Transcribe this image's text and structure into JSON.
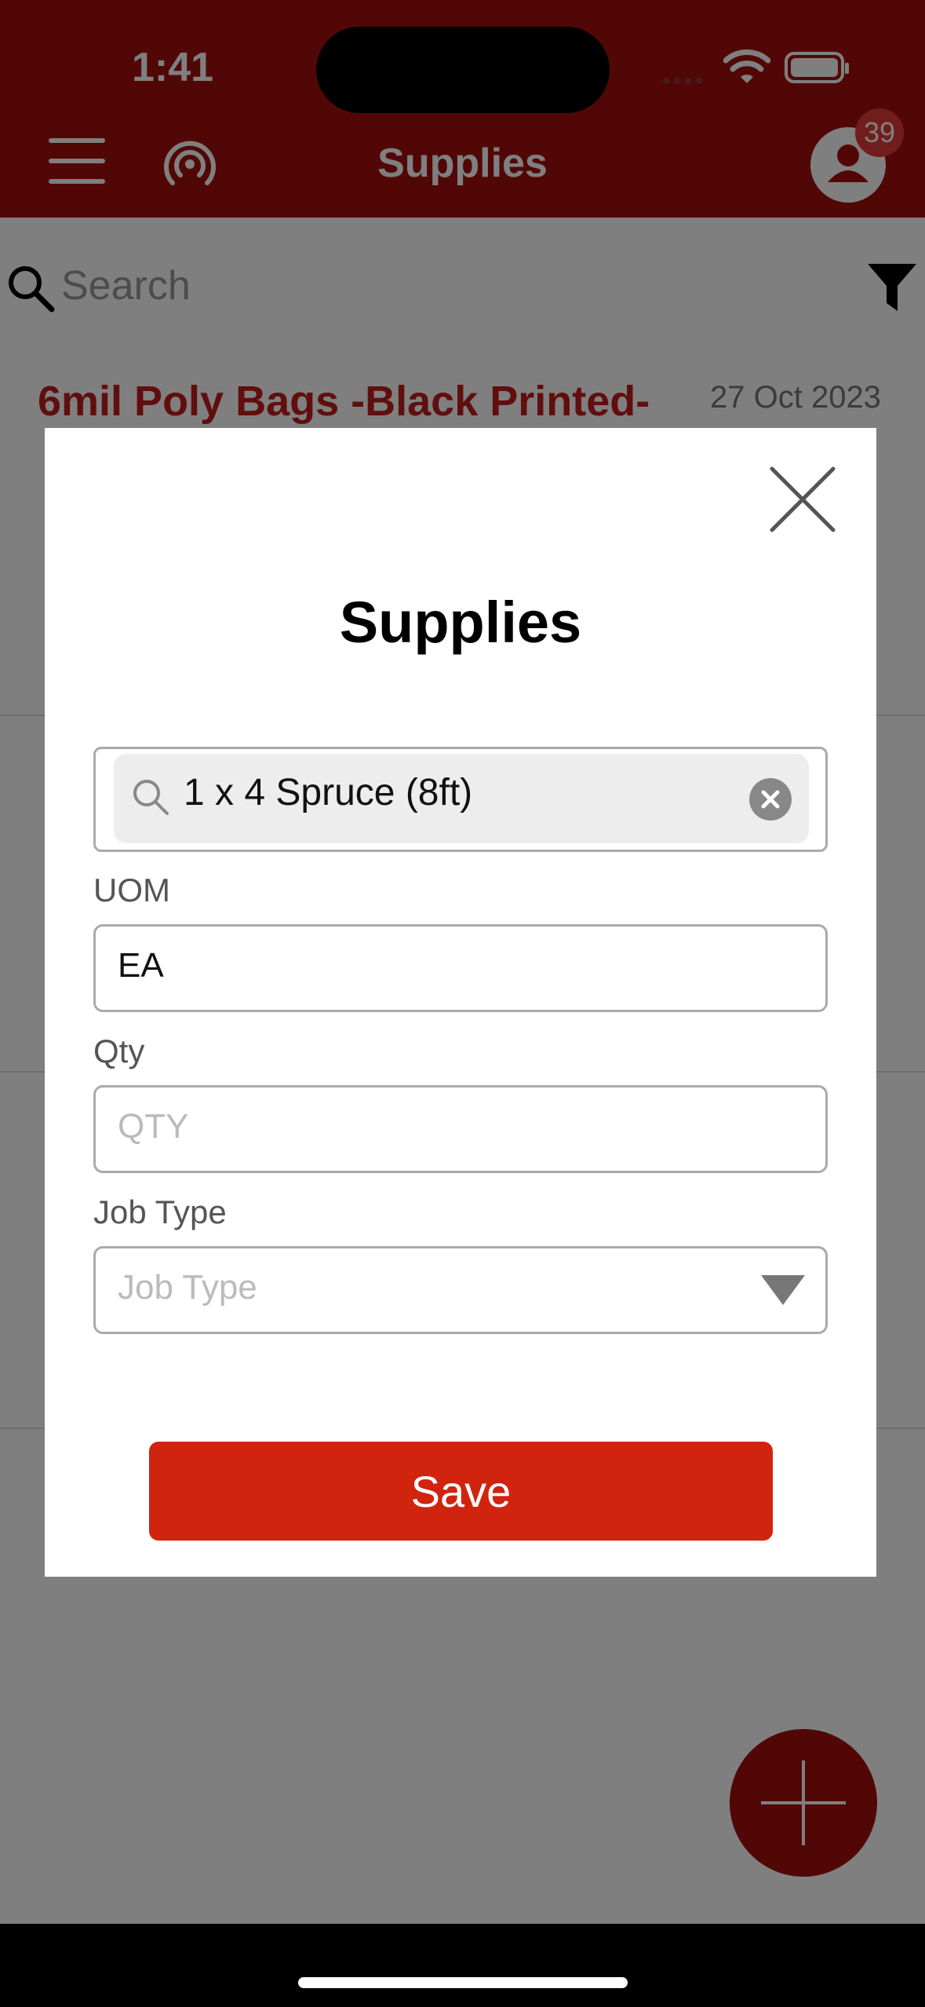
{
  "status": {
    "time": "1:41"
  },
  "header": {
    "title": "Supplies",
    "badge_count": "39"
  },
  "search": {
    "placeholder": "Search"
  },
  "list": {
    "first_item": {
      "title": "6mil Poly Bags -Black Printed-",
      "date": "27 Oct 2023"
    }
  },
  "modal": {
    "title": "Supplies",
    "supply_value": "1 x 4 Spruce (8ft)",
    "uom_label": "UOM",
    "uom_value": "EA",
    "qty_label": "Qty",
    "qty_placeholder": "QTY",
    "job_type_label": "Job Type",
    "job_type_placeholder": "Job Type",
    "save_label": "Save"
  },
  "colors": {
    "brand": "#a50f0f",
    "save": "#d1240f",
    "title_red": "#c31c1c"
  }
}
